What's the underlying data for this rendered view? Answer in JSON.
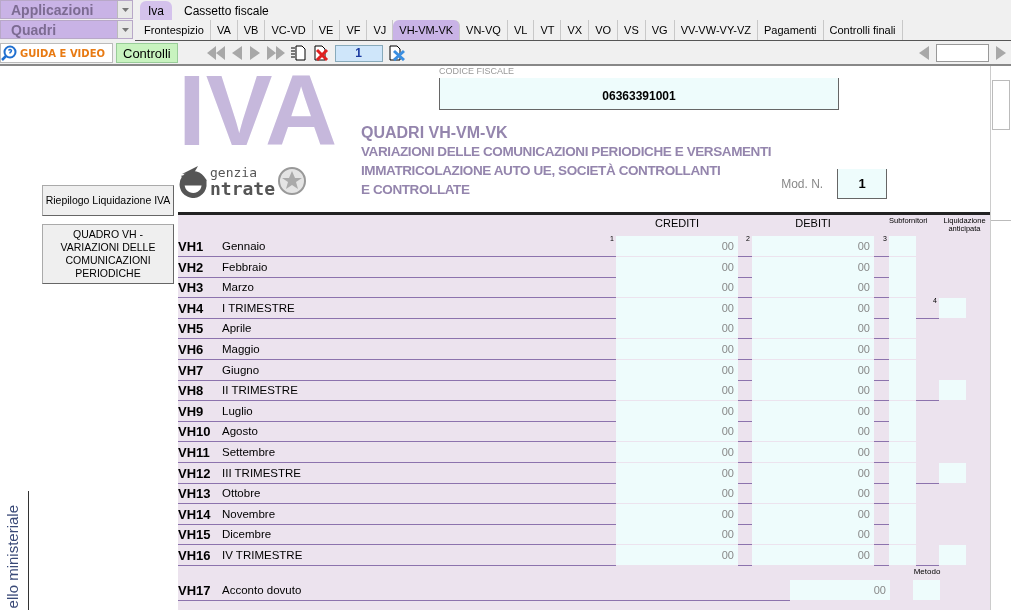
{
  "app_menus": [
    {
      "label": "Applicazioni"
    },
    {
      "label": "Quadri"
    }
  ],
  "top_tabs": [
    {
      "label": "Iva",
      "selected": true
    },
    {
      "label": "Cassetto fiscale",
      "selected": false
    }
  ],
  "quadri_tabs": [
    {
      "label": "Frontespizio",
      "selected": false
    },
    {
      "label": "VA",
      "selected": false
    },
    {
      "label": "VB",
      "selected": false
    },
    {
      "label": "VC-VD",
      "selected": false
    },
    {
      "label": "VE",
      "selected": false
    },
    {
      "label": "VF",
      "selected": false
    },
    {
      "label": "VJ",
      "selected": false
    },
    {
      "label": "VH-VM-VK",
      "selected": true
    },
    {
      "label": "VN-VQ",
      "selected": false
    },
    {
      "label": "VL",
      "selected": false
    },
    {
      "label": "VT",
      "selected": false
    },
    {
      "label": "VX",
      "selected": false
    },
    {
      "label": "VO",
      "selected": false
    },
    {
      "label": "VS",
      "selected": false
    },
    {
      "label": "VG",
      "selected": false
    },
    {
      "label": "VV-VW-VY-VZ",
      "selected": false
    },
    {
      "label": "Pagamenti",
      "selected": false
    },
    {
      "label": "Controlli finali",
      "selected": false
    }
  ],
  "toolbar": {
    "guide_button": "GUIDA E VIDEO",
    "controls_button": "Controlli",
    "page_number": "1"
  },
  "sidebar": {
    "buttons": [
      "Riepilogo Liquidazione IVA",
      "QUADRO VH - VARIAZIONI DELLE COMUNICAZIONI PERIODICHE"
    ],
    "vertical_text": "ello ministeriale"
  },
  "header": {
    "logo_letters": "IVA",
    "agency_top": "genzia",
    "agency_bottom": "ntrate",
    "codice_fiscale_label": "CODICE FISCALE",
    "codice_fiscale": "06363391001",
    "title": "QUADRI VH-VM-VK",
    "subtitle_lines": [
      "VARIAZIONI DELLE COMUNICAZIONI PERIODICHE E VERSAMENTI",
      "IMMATRICOLAZIONE AUTO UE, SOCIETÀ CONTROLLANTI",
      "E CONTROLLATE"
    ],
    "mod_label": "Mod. N.",
    "mod_value": "1"
  },
  "columns": {
    "credits": "CREDITI",
    "debits": "DEBITI",
    "subcontractors": "Subfornitori",
    "advance": "Liquidazione anticipata"
  },
  "rows": [
    {
      "code": "VH1",
      "label": "Gennaio",
      "kind": "month",
      "credits": "00",
      "debits": "00",
      "numbers": [
        "1",
        "2",
        "3"
      ]
    },
    {
      "code": "VH2",
      "label": "Febbraio",
      "kind": "month",
      "credits": "00",
      "debits": "00"
    },
    {
      "code": "VH3",
      "label": "Marzo",
      "kind": "month",
      "credits": "00",
      "debits": "00"
    },
    {
      "code": "VH4",
      "label": "I TRIMESTRE",
      "kind": "quarter",
      "credits": "00",
      "debits": "00",
      "advance_number": "4"
    },
    {
      "code": "VH5",
      "label": "Aprile",
      "kind": "month",
      "credits": "00",
      "debits": "00"
    },
    {
      "code": "VH6",
      "label": "Maggio",
      "kind": "month",
      "credits": "00",
      "debits": "00"
    },
    {
      "code": "VH7",
      "label": "Giugno",
      "kind": "month",
      "credits": "00",
      "debits": "00"
    },
    {
      "code": "VH8",
      "label": "II TRIMESTRE",
      "kind": "quarter",
      "credits": "00",
      "debits": "00"
    },
    {
      "code": "VH9",
      "label": "Luglio",
      "kind": "month",
      "credits": "00",
      "debits": "00"
    },
    {
      "code": "VH10",
      "label": "Agosto",
      "kind": "month",
      "credits": "00",
      "debits": "00"
    },
    {
      "code": "VH11",
      "label": "Settembre",
      "kind": "month",
      "credits": "00",
      "debits": "00"
    },
    {
      "code": "VH12",
      "label": "III TRIMESTRE",
      "kind": "quarter",
      "credits": "00",
      "debits": "00"
    },
    {
      "code": "VH13",
      "label": "Ottobre",
      "kind": "month",
      "credits": "00",
      "debits": "00"
    },
    {
      "code": "VH14",
      "label": "Novembre",
      "kind": "month",
      "credits": "00",
      "debits": "00"
    },
    {
      "code": "VH15",
      "label": "Dicembre",
      "kind": "month",
      "credits": "00",
      "debits": "00"
    },
    {
      "code": "VH16",
      "label": "IV TRIMESTRE",
      "kind": "quarter",
      "credits": "00",
      "debits": "00"
    }
  ],
  "advance_row": {
    "code": "VH17",
    "label": "Acconto dovuto",
    "value": "00",
    "method_label": "Metodo"
  }
}
